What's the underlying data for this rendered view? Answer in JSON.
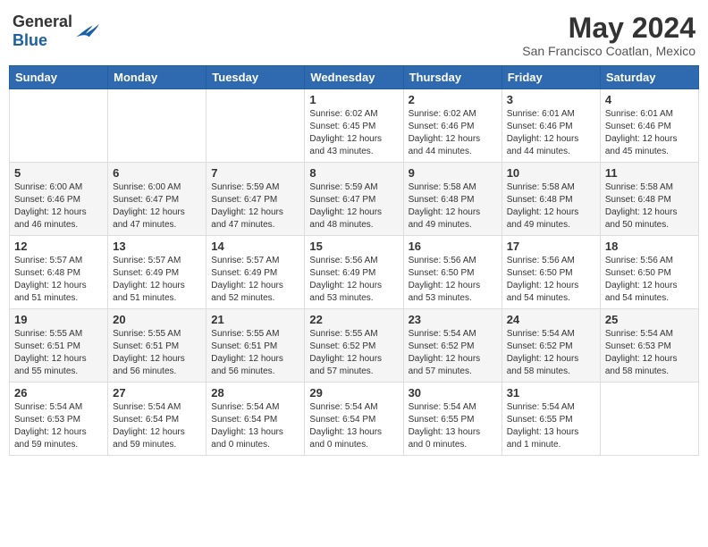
{
  "header": {
    "logo_general": "General",
    "logo_blue": "Blue",
    "month_title": "May 2024",
    "location": "San Francisco Coatlan, Mexico"
  },
  "days_of_week": [
    "Sunday",
    "Monday",
    "Tuesday",
    "Wednesday",
    "Thursday",
    "Friday",
    "Saturday"
  ],
  "weeks": [
    [
      {
        "day": "",
        "info": ""
      },
      {
        "day": "",
        "info": ""
      },
      {
        "day": "",
        "info": ""
      },
      {
        "day": "1",
        "info": "Sunrise: 6:02 AM\nSunset: 6:45 PM\nDaylight: 12 hours\nand 43 minutes."
      },
      {
        "day": "2",
        "info": "Sunrise: 6:02 AM\nSunset: 6:46 PM\nDaylight: 12 hours\nand 44 minutes."
      },
      {
        "day": "3",
        "info": "Sunrise: 6:01 AM\nSunset: 6:46 PM\nDaylight: 12 hours\nand 44 minutes."
      },
      {
        "day": "4",
        "info": "Sunrise: 6:01 AM\nSunset: 6:46 PM\nDaylight: 12 hours\nand 45 minutes."
      }
    ],
    [
      {
        "day": "5",
        "info": "Sunrise: 6:00 AM\nSunset: 6:46 PM\nDaylight: 12 hours\nand 46 minutes."
      },
      {
        "day": "6",
        "info": "Sunrise: 6:00 AM\nSunset: 6:47 PM\nDaylight: 12 hours\nand 47 minutes."
      },
      {
        "day": "7",
        "info": "Sunrise: 5:59 AM\nSunset: 6:47 PM\nDaylight: 12 hours\nand 47 minutes."
      },
      {
        "day": "8",
        "info": "Sunrise: 5:59 AM\nSunset: 6:47 PM\nDaylight: 12 hours\nand 48 minutes."
      },
      {
        "day": "9",
        "info": "Sunrise: 5:58 AM\nSunset: 6:48 PM\nDaylight: 12 hours\nand 49 minutes."
      },
      {
        "day": "10",
        "info": "Sunrise: 5:58 AM\nSunset: 6:48 PM\nDaylight: 12 hours\nand 49 minutes."
      },
      {
        "day": "11",
        "info": "Sunrise: 5:58 AM\nSunset: 6:48 PM\nDaylight: 12 hours\nand 50 minutes."
      }
    ],
    [
      {
        "day": "12",
        "info": "Sunrise: 5:57 AM\nSunset: 6:48 PM\nDaylight: 12 hours\nand 51 minutes."
      },
      {
        "day": "13",
        "info": "Sunrise: 5:57 AM\nSunset: 6:49 PM\nDaylight: 12 hours\nand 51 minutes."
      },
      {
        "day": "14",
        "info": "Sunrise: 5:57 AM\nSunset: 6:49 PM\nDaylight: 12 hours\nand 52 minutes."
      },
      {
        "day": "15",
        "info": "Sunrise: 5:56 AM\nSunset: 6:49 PM\nDaylight: 12 hours\nand 53 minutes."
      },
      {
        "day": "16",
        "info": "Sunrise: 5:56 AM\nSunset: 6:50 PM\nDaylight: 12 hours\nand 53 minutes."
      },
      {
        "day": "17",
        "info": "Sunrise: 5:56 AM\nSunset: 6:50 PM\nDaylight: 12 hours\nand 54 minutes."
      },
      {
        "day": "18",
        "info": "Sunrise: 5:56 AM\nSunset: 6:50 PM\nDaylight: 12 hours\nand 54 minutes."
      }
    ],
    [
      {
        "day": "19",
        "info": "Sunrise: 5:55 AM\nSunset: 6:51 PM\nDaylight: 12 hours\nand 55 minutes."
      },
      {
        "day": "20",
        "info": "Sunrise: 5:55 AM\nSunset: 6:51 PM\nDaylight: 12 hours\nand 56 minutes."
      },
      {
        "day": "21",
        "info": "Sunrise: 5:55 AM\nSunset: 6:51 PM\nDaylight: 12 hours\nand 56 minutes."
      },
      {
        "day": "22",
        "info": "Sunrise: 5:55 AM\nSunset: 6:52 PM\nDaylight: 12 hours\nand 57 minutes."
      },
      {
        "day": "23",
        "info": "Sunrise: 5:54 AM\nSunset: 6:52 PM\nDaylight: 12 hours\nand 57 minutes."
      },
      {
        "day": "24",
        "info": "Sunrise: 5:54 AM\nSunset: 6:52 PM\nDaylight: 12 hours\nand 58 minutes."
      },
      {
        "day": "25",
        "info": "Sunrise: 5:54 AM\nSunset: 6:53 PM\nDaylight: 12 hours\nand 58 minutes."
      }
    ],
    [
      {
        "day": "26",
        "info": "Sunrise: 5:54 AM\nSunset: 6:53 PM\nDaylight: 12 hours\nand 59 minutes."
      },
      {
        "day": "27",
        "info": "Sunrise: 5:54 AM\nSunset: 6:54 PM\nDaylight: 12 hours\nand 59 minutes."
      },
      {
        "day": "28",
        "info": "Sunrise: 5:54 AM\nSunset: 6:54 PM\nDaylight: 13 hours\nand 0 minutes."
      },
      {
        "day": "29",
        "info": "Sunrise: 5:54 AM\nSunset: 6:54 PM\nDaylight: 13 hours\nand 0 minutes."
      },
      {
        "day": "30",
        "info": "Sunrise: 5:54 AM\nSunset: 6:55 PM\nDaylight: 13 hours\nand 0 minutes."
      },
      {
        "day": "31",
        "info": "Sunrise: 5:54 AM\nSunset: 6:55 PM\nDaylight: 13 hours\nand 1 minute."
      },
      {
        "day": "",
        "info": ""
      }
    ]
  ]
}
